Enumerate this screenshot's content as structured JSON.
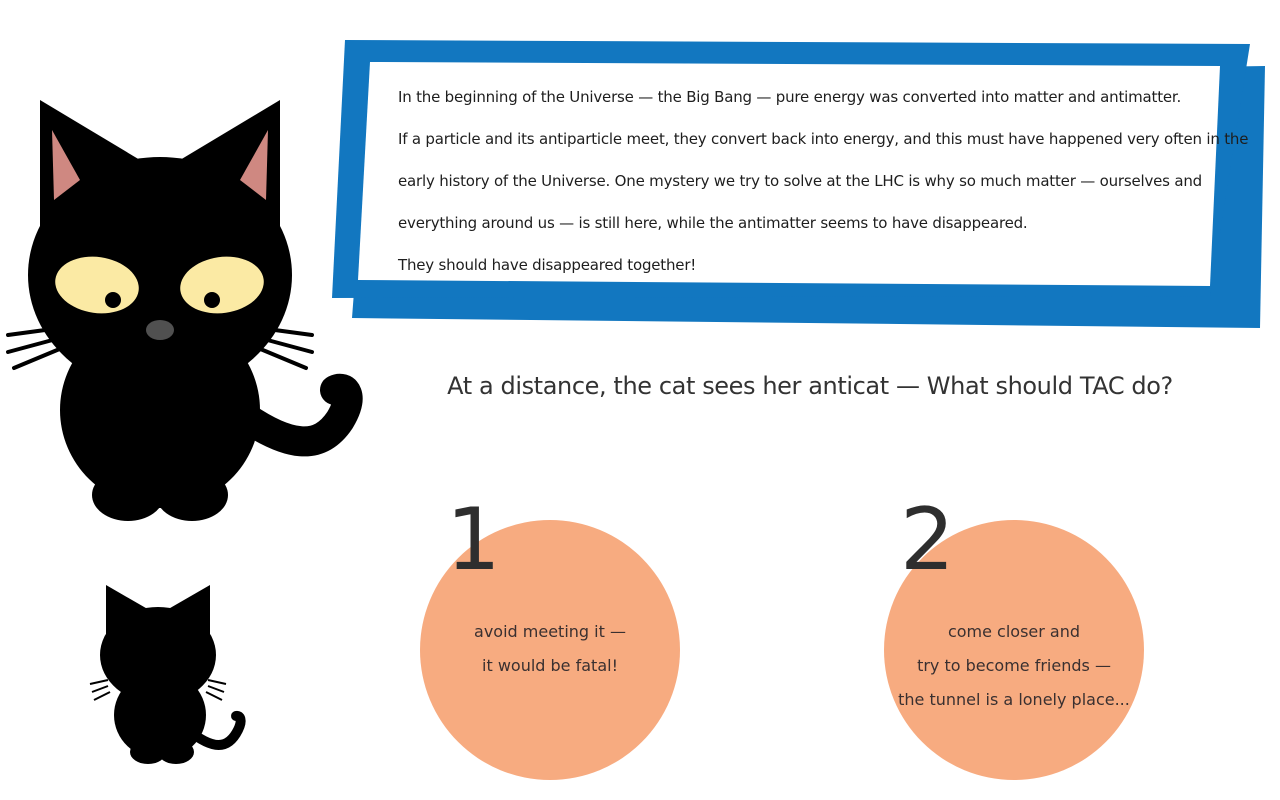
{
  "intro": {
    "lines": [
      "In the beginning of the Universe — the Big Bang — pure energy was converted into matter and antimatter.",
      "If a particle and its antiparticle meet, they convert back into energy, and this must have happened very often in the",
      "early history of the Universe. One mystery we try to solve at the LHC is  why so much matter — ourselves and",
      "everything around us — is still here, while the antimatter seems to have disappeared.",
      "They should have disappeared together!"
    ]
  },
  "question": "At a distance, the cat sees her anticat —  What should TAC do?",
  "choices": [
    {
      "number": "1",
      "lines": [
        "avoid meeting it —",
        "it would be fatal!"
      ]
    },
    {
      "number": "2",
      "lines": [
        "come closer and",
        "try to become friends —",
        "the tunnel is a lonely place..."
      ]
    }
  ],
  "colors": {
    "banner_blue": "#1277c0",
    "choice_orange": "#f7ab80",
    "cat_black": "#000000",
    "cat_eye": "#fbeaa4",
    "ear_pink": "#cf8881"
  },
  "icons": [
    "black-cat-illustration",
    "small-cat-back-illustration"
  ]
}
